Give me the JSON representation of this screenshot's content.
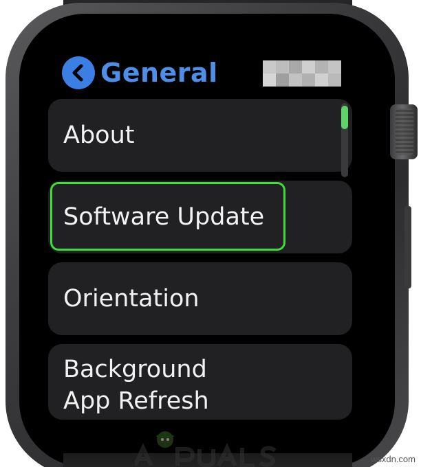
{
  "header": {
    "title": "General",
    "back_icon": "chevron-left-icon",
    "accent_color": "#3b7fe4"
  },
  "list": {
    "items": [
      {
        "label": "About"
      },
      {
        "label": "Software Update",
        "highlighted": true
      },
      {
        "label": "Orientation"
      },
      {
        "label_lines": [
          "Background",
          "App Refresh"
        ]
      }
    ]
  },
  "highlight_color": "#3fdc3a",
  "scroll_indicator_color": "#5fd36a",
  "watermark": {
    "brand": "APPUALS",
    "site": "wsxdn.com"
  }
}
